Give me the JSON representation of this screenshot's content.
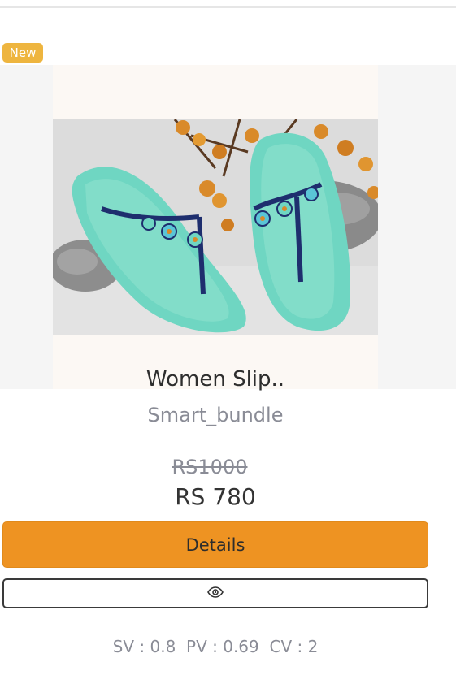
{
  "badge": {
    "label": "New"
  },
  "product": {
    "name": "Women Slip..",
    "brand": "Smart_bundle",
    "price_old": "RS1000",
    "price_new": "RS 780"
  },
  "actions": {
    "details_label": "Details",
    "view_icon": "eye-icon"
  },
  "stats": {
    "sv": "SV : 0.8",
    "pv": "PV : 0.69",
    "cv": "CV : 2"
  },
  "colors": {
    "badge": "#eeb53f",
    "details_button": "#ee9322",
    "sandal": "#6fd6c2",
    "strap": "#1e2e6e"
  }
}
